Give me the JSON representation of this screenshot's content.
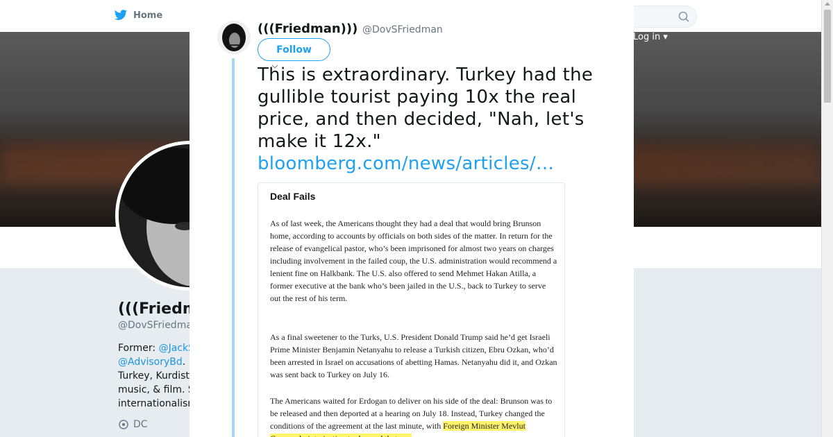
{
  "nav": {
    "home_label": "Home",
    "login_label": "Log in",
    "search_icon": "search-icon",
    "bird_icon": "twitter-bird-icon"
  },
  "profile_background": {
    "name": "(((Friedm",
    "handle": "@DovSFriedma",
    "bio_prefix": "Former: ",
    "bio_link1": "@JackS",
    "bio_link2": "@AdvisoryBd",
    "bio_after_link2": ". (",
    "bio_line3": "Turkey, Kurdist",
    "bio_line4": "music, & film. S",
    "bio_line5": "internationalism",
    "location": "DC"
  },
  "modal": {
    "author_name": "(((Friedman)))",
    "author_handle": "@DovSFriedman",
    "follow_label": "Follow",
    "tweet_text": "This is extraordinary. Turkey had the gullible tourist paying 10x the real price, and then decided, \"Nah, let's make it 12x.\"",
    "tweet_link": "bloomberg.com/news/articles/…",
    "media": {
      "heading": "Deal Fails",
      "paragraph1": "As of last week, the Americans thought they had a deal that would bring Brunson home, according to accounts by officials on both sides of the matter. In return for the release of evangelical pastor, who’s been imprisoned for almost two years on charges including involvement in the failed coup, the U.S. administration would recommend a lenient fine on Halkbank. The U.S. also offered to send Mehmet Hakan Atilla, a former executive at the bank who’s been jailed in the U.S., back to Turkey to serve out the rest of his term.",
      "paragraph2": "As a final sweetener to the Turks, U.S. President Donald Trump said he’d get Israeli Prime Minister Benjamin Netanyahu to release a Turkish citizen, Ebru Ozkan, who’d been arrested in Israel on accusations of abetting Hamas. Netanyahu did it, and Ozkan was sent back to Turkey on July 16.",
      "paragraph3_start": "The Americans waited for Erdogan to deliver on his side of the deal: Brunson was to be released and then deported at a hearing on July 18. Instead, Turkey changed the conditions of the agreement at the last minute, with ",
      "paragraph3_highlight": "Foreign Minister Mevlut Cavusoglu interjecting to demand that any"
    }
  },
  "colors": {
    "twitter_blue": "#1da1f2",
    "highlight_yellow": "#fff46a",
    "thread_line": "#a8d8f5"
  },
  "close_icon": "close-icon"
}
